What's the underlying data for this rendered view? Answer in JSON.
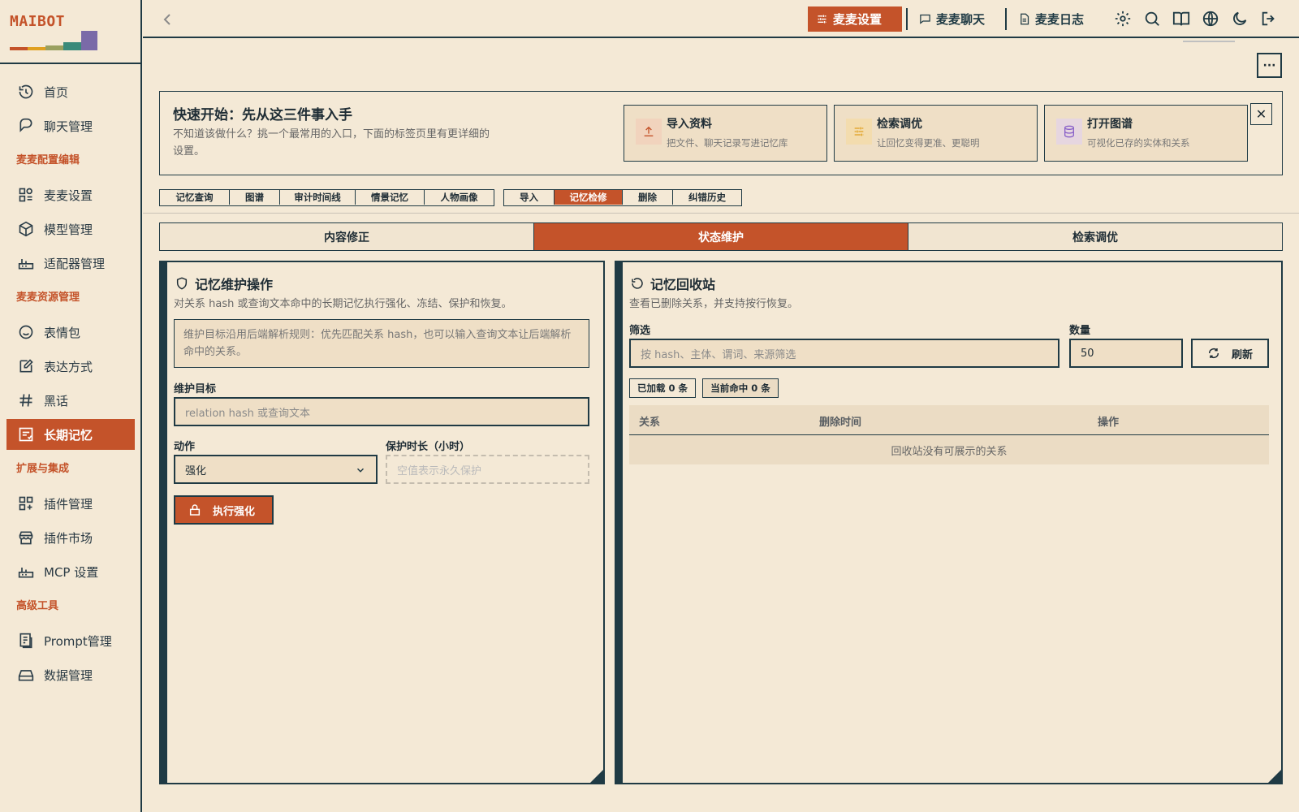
{
  "app": {
    "logo": "MAIBOT"
  },
  "colors": {
    "accent": "#c4532a",
    "ink": "#1f3a44",
    "background": "#f4e9d6"
  },
  "sidebar": {
    "items": [
      {
        "label": "首页",
        "icon": "history-icon"
      },
      {
        "label": "聊天管理",
        "icon": "chat-bubble-icon"
      },
      {
        "group": "麦麦配置编辑"
      },
      {
        "label": "麦麦设置",
        "icon": "settings-grid-icon"
      },
      {
        "label": "模型管理",
        "icon": "cube-icon"
      },
      {
        "label": "适配器管理",
        "icon": "router-icon"
      },
      {
        "group": "麦麦资源管理"
      },
      {
        "label": "表情包",
        "icon": "smiley-icon"
      },
      {
        "label": "表达方式",
        "icon": "edit-note-icon"
      },
      {
        "label": "黑话",
        "icon": "hash-icon"
      },
      {
        "label": "长期记忆",
        "icon": "memory-icon",
        "active": true
      },
      {
        "group": "扩展与集成"
      },
      {
        "label": "插件管理",
        "icon": "plugin-grid-icon"
      },
      {
        "label": "插件市场",
        "icon": "store-icon"
      },
      {
        "label": "MCP 设置",
        "icon": "router-icon"
      },
      {
        "group": "高级工具"
      },
      {
        "label": "Prompt管理",
        "icon": "document-icon"
      },
      {
        "label": "数据管理",
        "icon": "drive-icon"
      }
    ]
  },
  "topbar": {
    "tabs": [
      {
        "label": "麦麦设置",
        "icon": "sliders-icon",
        "active": true
      },
      {
        "label": "麦麦聊天",
        "icon": "chat-icon"
      },
      {
        "label": "麦麦日志",
        "icon": "file-icon"
      }
    ],
    "icons": [
      "gear-icon",
      "search-icon",
      "book-icon",
      "globe-icon",
      "moon-icon",
      "logout-icon"
    ],
    "more": "···"
  },
  "quick_start": {
    "title": "快速开始：先从这三件事入手",
    "description": "不知道该做什么？挑一个最常用的入口，下面的标签页里有更详细的设置。",
    "cards": [
      {
        "title": "导入资料",
        "desc": "把文件、聊天记录写进记忆库",
        "icon": "upload-icon",
        "color": "#c4532a",
        "bg": "#f1d3bd"
      },
      {
        "title": "检索调优",
        "desc": "让回忆变得更准、更聪明",
        "icon": "sliders-icon",
        "color": "#e0a020",
        "bg": "#f3dcae"
      },
      {
        "title": "打开图谱",
        "desc": "可视化已存的实体和关系",
        "icon": "database-icon",
        "color": "#8a62c8",
        "bg": "#e6d6e0"
      }
    ],
    "close": "✕"
  },
  "tab_group_a": [
    "记忆查询",
    "图谱",
    "审计时间线",
    "情景记忆",
    "人物画像"
  ],
  "tab_group_b": [
    "导入",
    "记忆检修",
    "删除",
    "纠错历史"
  ],
  "tab_group_b_active": 1,
  "sub_tabs": [
    "内容修正",
    "状态维护",
    "检索调优"
  ],
  "sub_tabs_active": 1,
  "maintenance": {
    "title": "记忆维护操作",
    "subtitle": "对关系 hash 或查询文本命中的长期记忆执行强化、冻结、保护和恢复。",
    "note": "维护目标沿用后端解析规则：优先匹配关系 hash，也可以输入查询文本让后端解析命中的关系。",
    "target_label": "维护目标",
    "target_placeholder": "relation hash 或查询文本",
    "action_label": "动作",
    "action_value": "强化",
    "duration_label": "保护时长（小时）",
    "duration_placeholder": "空值表示永久保护",
    "execute_label": "执行强化"
  },
  "recycle": {
    "title": "记忆回收站",
    "subtitle": "查看已删除关系，并支持按行恢复。",
    "filter_label": "筛选",
    "filter_placeholder": "按 hash、主体、谓词、来源筛选",
    "count_label": "数量",
    "count_value": "50",
    "refresh_label": "刷新",
    "loaded_badge": "已加载 0 条",
    "hit_badge": "当前命中 0 条",
    "columns": [
      "关系",
      "删除时间",
      "操作"
    ],
    "empty": "回收站没有可展示的关系"
  }
}
